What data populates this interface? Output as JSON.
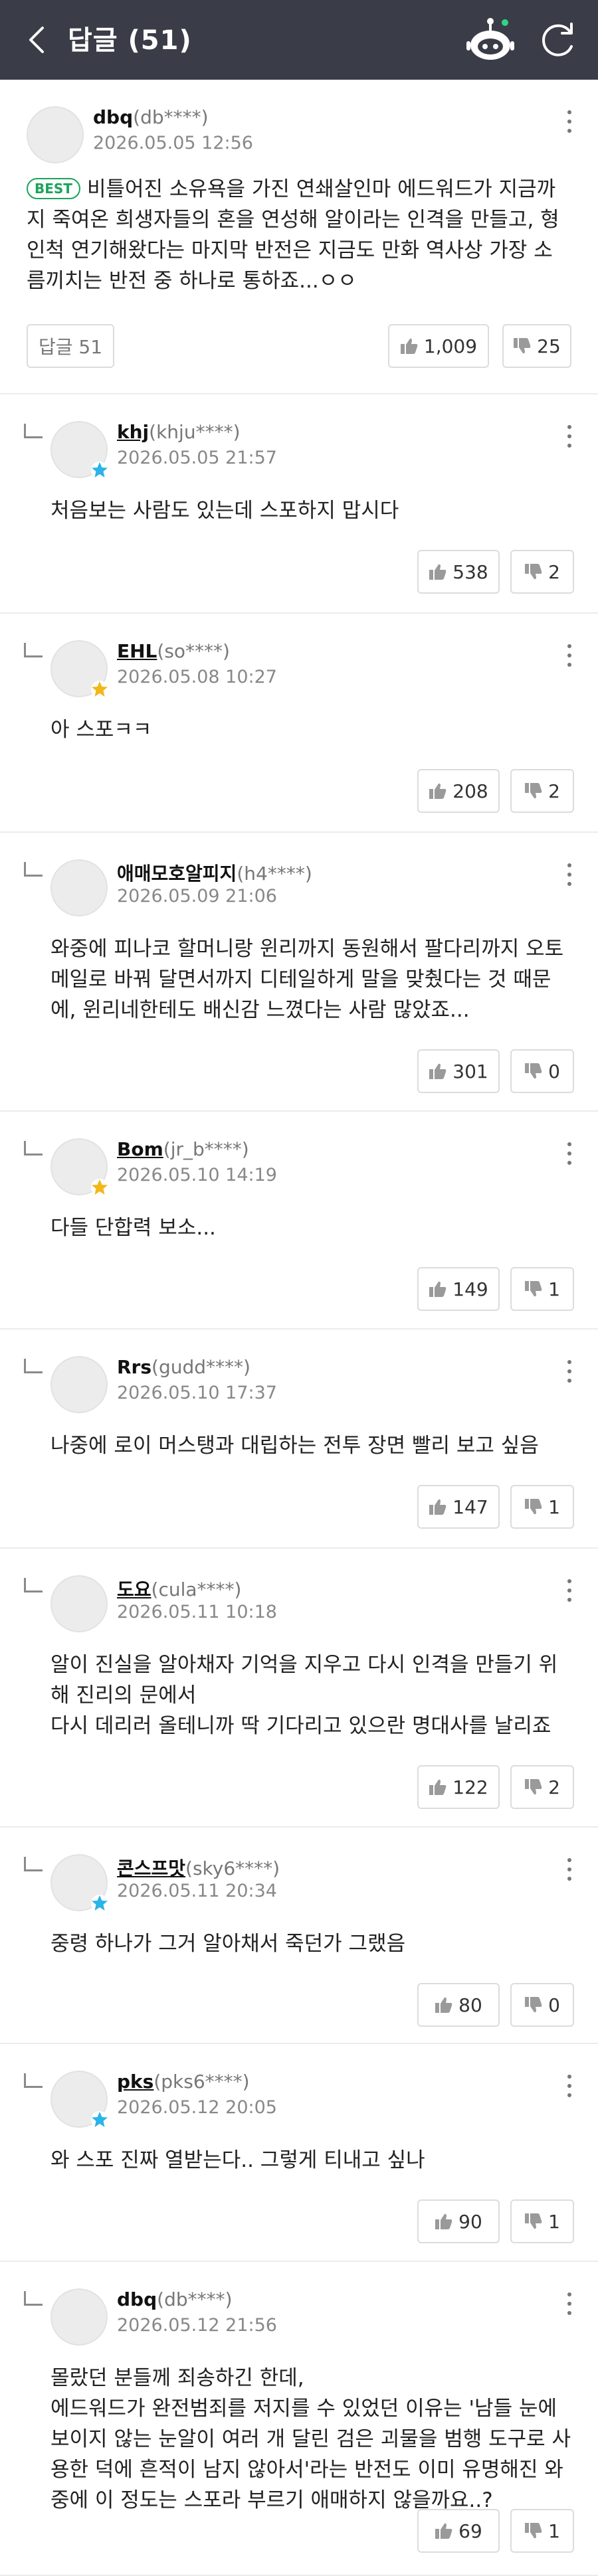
{
  "header": {
    "title": "답글 (51)"
  },
  "main_comment": {
    "nickname": "dbq",
    "user_id": "(db****)",
    "date": "2026.05.05 12:56",
    "best_label": "BEST",
    "text": "비틀어진 소유욕을 가진 연쇄살인마 에드워드가 지금까지 죽여온 희생자들의 혼을 연성해 알이라는 인격을 만들고, 형인척 연기해왔다는 마지막 반전은 지금도 만화 역사상 가장 소름끼치는 반전 중 하나로 통하죠...ㅇㅇ",
    "reply_button": "답글 51",
    "likes": "1,009",
    "dislikes": "25"
  },
  "replies": [
    {
      "nickname": "khj",
      "user_id": "(khju****)",
      "date": "2026.05.05 21:57",
      "text": "처음보는 사람도 있는데 스포하지 맙시다",
      "likes": "538",
      "dislikes": "2",
      "badge": "blue-star"
    },
    {
      "nickname": "EHL",
      "user_id": "(so****)",
      "date": "2026.05.08 10:27",
      "text": "아 스포ㅋㅋ",
      "likes": "208",
      "dislikes": "2",
      "badge": "gold-star"
    },
    {
      "nickname": "애매모호알피지",
      "user_id": "(h4****)",
      "date": "2026.05.09 21:06",
      "text": "와중에 피나코 할머니랑 윈리까지 동원해서 팔다리까지 오토메일로 바꿔 달면서까지 디테일하게 말을 맞췄다는 것 때문에, 윈리네한테도 배신감 느꼈다는 사람 많았죠...",
      "likes": "301",
      "dislikes": "0",
      "badge": ""
    },
    {
      "nickname": "Bom",
      "user_id": "(jr_b****)",
      "date": "2026.05.10 14:19",
      "text": "다들 단합력 보소...",
      "likes": "149",
      "dislikes": "1",
      "badge": "gold-star"
    },
    {
      "nickname": "Rrs",
      "user_id": "(gudd****)",
      "date": "2026.05.10 17:37",
      "text": "나중에 로이 머스탱과 대립하는 전투 장면 빨리 보고 싶음",
      "likes": "147",
      "dislikes": "1",
      "badge": ""
    },
    {
      "nickname": "도요",
      "user_id": "(cula****)",
      "date": "2026.05.11 10:18",
      "text": "알이 진실을 알아채자 기억을 지우고 다시 인격을 만들기 위해 진리의 문에서\n다시 데리러 올테니까 딱 기다리고 있으란 명대사를 날리죠",
      "likes": "122",
      "dislikes": "2",
      "badge": ""
    },
    {
      "nickname": "콘스프맛",
      "user_id": "(sky6****)",
      "date": "2026.05.11 20:34",
      "text": "중령 하나가 그거 알아채서 죽던가 그랬음",
      "likes": "80",
      "dislikes": "0",
      "badge": "blue-star"
    },
    {
      "nickname": "pks",
      "user_id": "(pks6****)",
      "date": "2026.05.12 20:05",
      "text": "와 스포 진짜 열받는다.. 그렇게 티내고 싶나",
      "likes": "90",
      "dislikes": "1",
      "badge": "blue-star"
    },
    {
      "nickname": "dbq",
      "user_id": "(db****)",
      "date": "2026.05.12 21:56",
      "text": "몰랐던 분들께 죄송하긴 한데,\n에드워드가 완전범죄를 저지를 수 있었던 이유는 '남들 눈에 보이지 않는 눈알이 여러 개 달린 검은 괴물을 범행 도구로 사용한 덕에 흔적이 남지 않아서'라는 반전도 이미 유명해진 와중에 이 정도는 스포라 부르기 애매하지 않을까요..?",
      "likes": "69",
      "dislikes": "1",
      "badge": ""
    }
  ],
  "colors": {
    "header_bg": "#3a3c47",
    "best_green": "#1aa35a",
    "star_blue": "#2ab4e8",
    "star_gold": "#f2b718"
  }
}
